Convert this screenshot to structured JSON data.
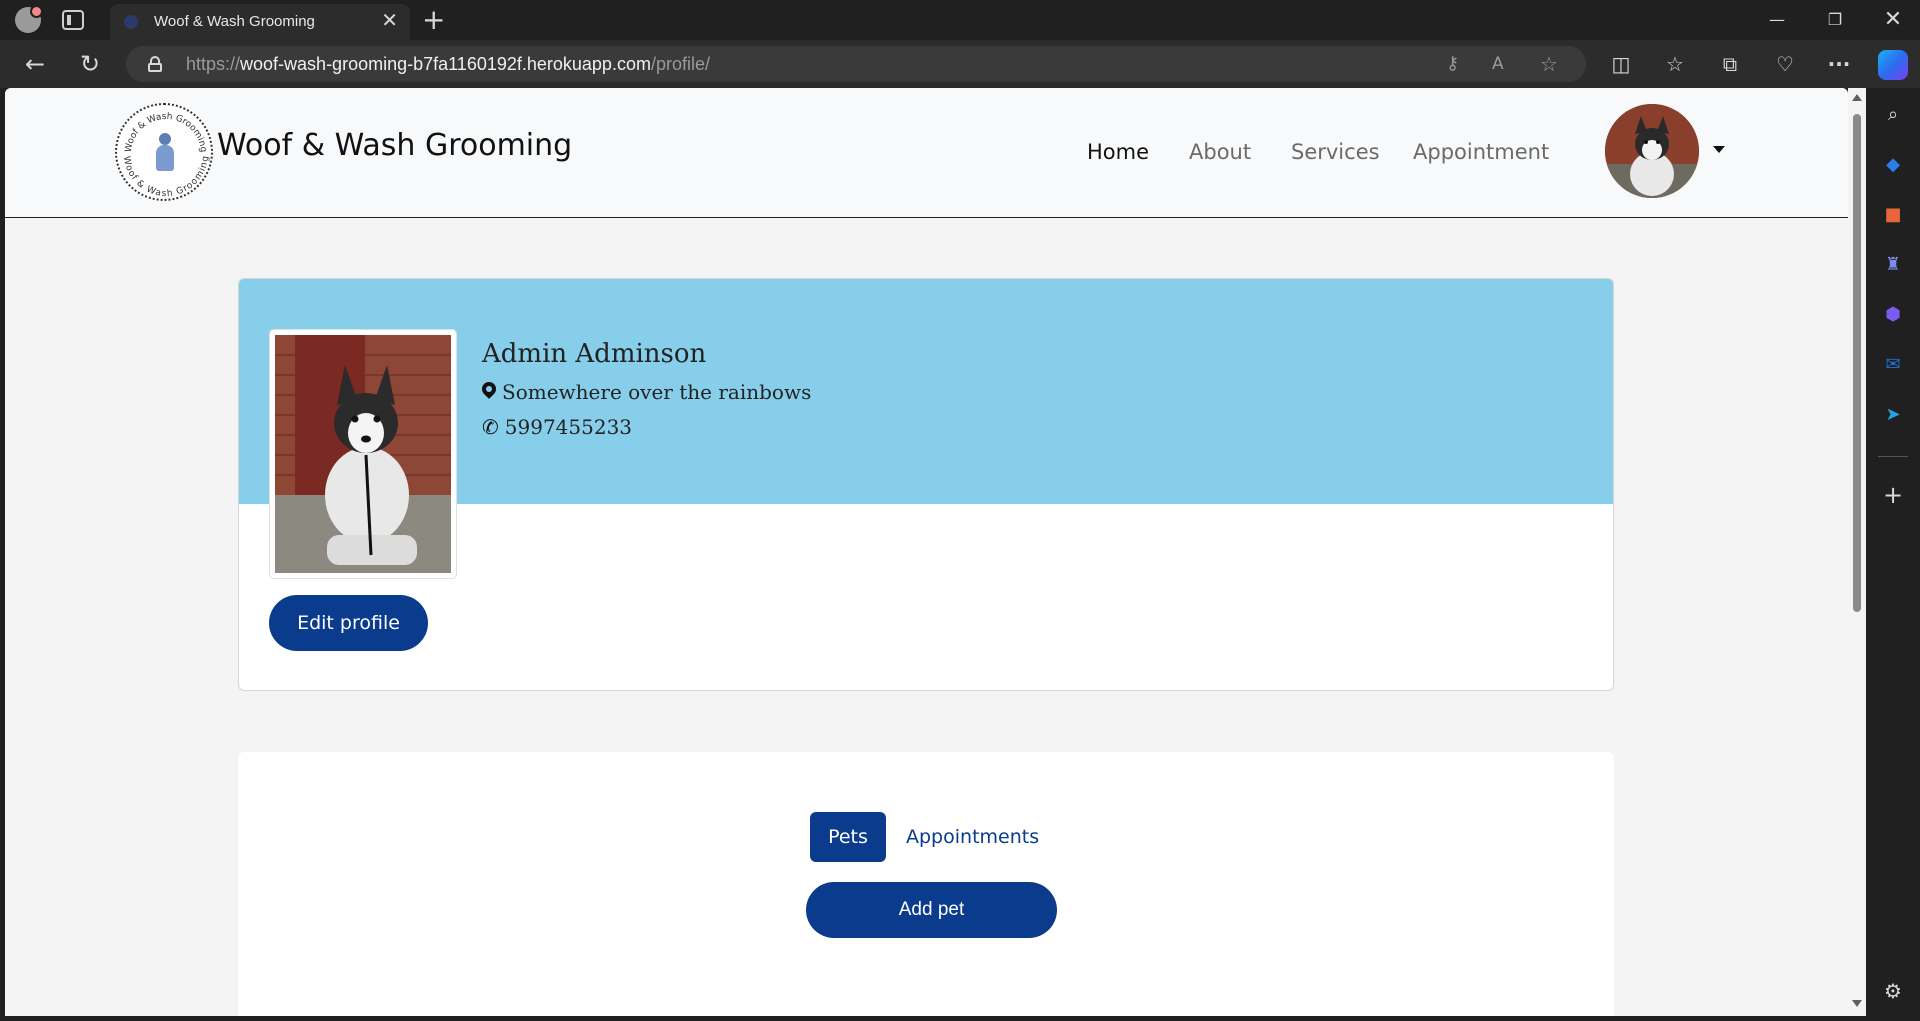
{
  "browser": {
    "tab_title": "Woof & Wash Grooming",
    "url_prefix": "https://",
    "url_host": "woof-wash-grooming-b7fa1160192f.herokuapp.com",
    "url_path": "/profile/"
  },
  "site": {
    "brand": "Woof & Wash Grooming",
    "logo_ring_text": "Woof & Wash Grooming",
    "nav": {
      "home": "Home",
      "about": "About",
      "services": "Services",
      "appointment": "Appointment"
    }
  },
  "profile": {
    "name": "Admin Adminson",
    "location": "Somewhere over the rainbows",
    "phone": "5997455233",
    "edit_label": "Edit profile",
    "banner_color": "#87ceeb"
  },
  "pets_section": {
    "tab_pets": "Pets",
    "tab_appointments": "Appointments",
    "add_pet_label": "Add pet",
    "accent_color": "#0b3b8c"
  }
}
